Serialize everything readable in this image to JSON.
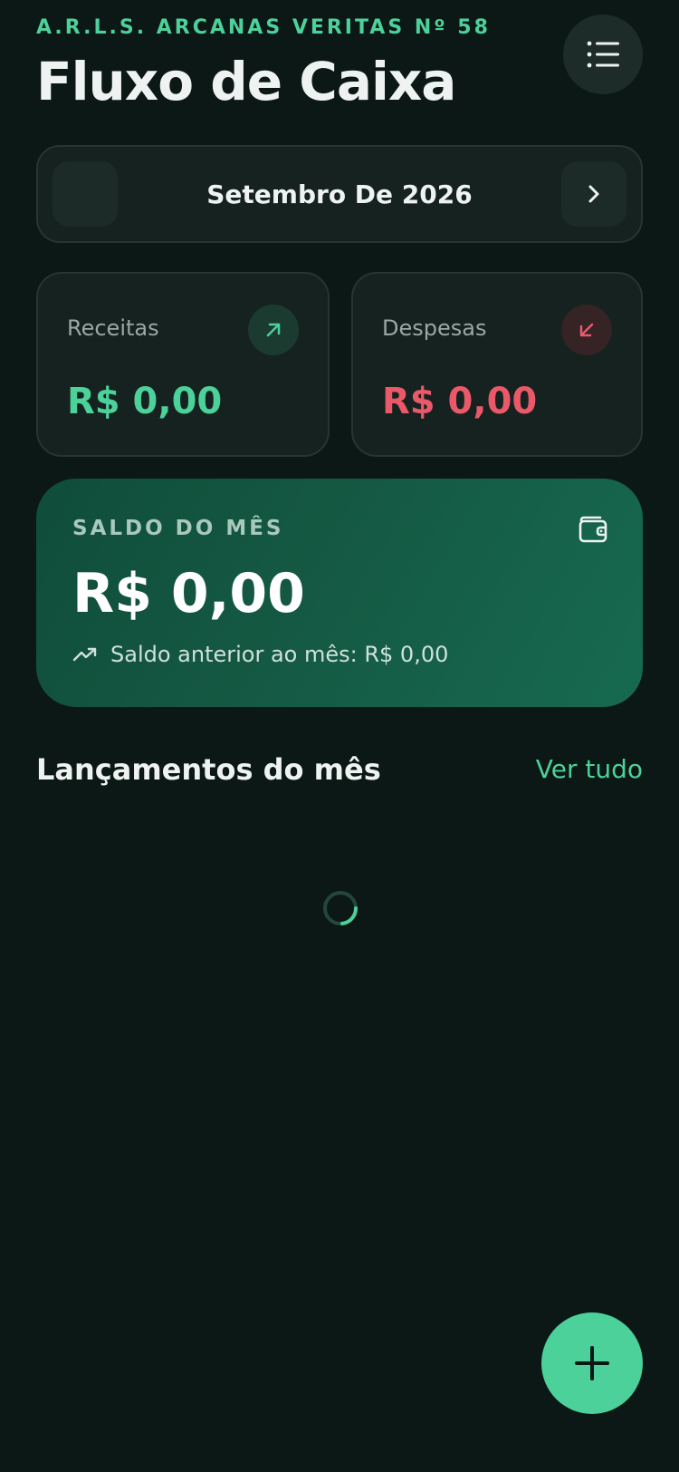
{
  "header": {
    "organization": "A.R.L.S. ARCANAS VERITAS Nº 58",
    "title": "Fluxo de Caixa",
    "menu_icon": "list-menu-icon"
  },
  "month_selector": {
    "label": "Setembro De 2026",
    "next_icon": "chevron-right-icon"
  },
  "summary": {
    "income": {
      "label": "Receitas",
      "value": "R$ 0,00",
      "icon": "arrow-up-right-icon",
      "color": "#4cd19a"
    },
    "expense": {
      "label": "Despesas",
      "value": "R$ 0,00",
      "icon": "arrow-down-left-icon",
      "color": "#e9596a"
    }
  },
  "balance": {
    "label": "SALDO DO MÊS",
    "value": "R$ 0,00",
    "previous": "Saldo anterior ao mês: R$ 0,00",
    "icon": "wallet-icon",
    "trend_icon": "trending-up-icon"
  },
  "entries": {
    "title": "Lançamentos do mês",
    "see_all": "Ver tudo",
    "loading": true
  },
  "fab": {
    "icon": "plus-icon"
  },
  "colors": {
    "background": "#0c1815",
    "accent": "#4cd19a",
    "danger": "#e9596a",
    "card": "#16221f"
  }
}
